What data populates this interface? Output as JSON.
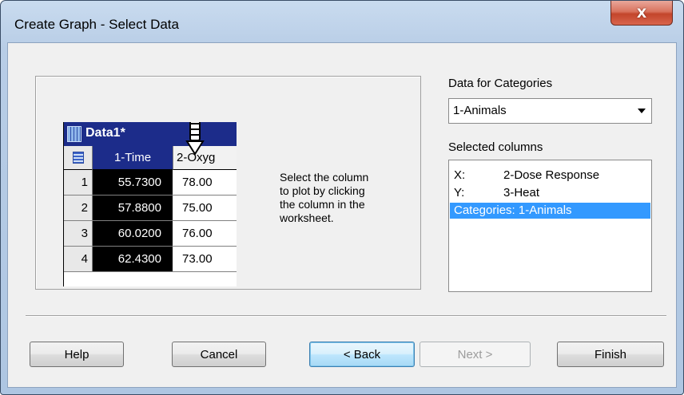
{
  "window": {
    "title": "Create Graph - Select Data",
    "close_glyph": "X"
  },
  "illustration": {
    "worksheet_title": "Data1*",
    "col1_header": "1-Time",
    "col2_header": "2-Oxyg",
    "rows": [
      {
        "num": "1",
        "c1": "55.7300",
        "c2": "78.00"
      },
      {
        "num": "2",
        "c1": "57.8800",
        "c2": "75.00"
      },
      {
        "num": "3",
        "c1": "60.0200",
        "c2": "76.00"
      },
      {
        "num": "4",
        "c1": "62.4300",
        "c2": "73.00"
      }
    ],
    "instruction": "Select the column\nto plot by clicking\nthe column in the\nworksheet."
  },
  "categories": {
    "label": "Data for Categories",
    "selected_value": "1-Animals"
  },
  "selected_columns": {
    "label": "Selected columns",
    "items": [
      {
        "key": "X:",
        "value": "2-Dose Response"
      },
      {
        "key": "Y:",
        "value": "3-Heat"
      },
      {
        "key": "",
        "value": "Categories: 1-Animals"
      }
    ]
  },
  "buttons": {
    "help": "Help",
    "cancel": "Cancel",
    "back": "< Back",
    "next": "Next >",
    "finish": "Finish"
  },
  "colors": {
    "selection": "#3399ff",
    "worksheet_header": "#1c2c8a",
    "close_button": "#c3452b"
  }
}
